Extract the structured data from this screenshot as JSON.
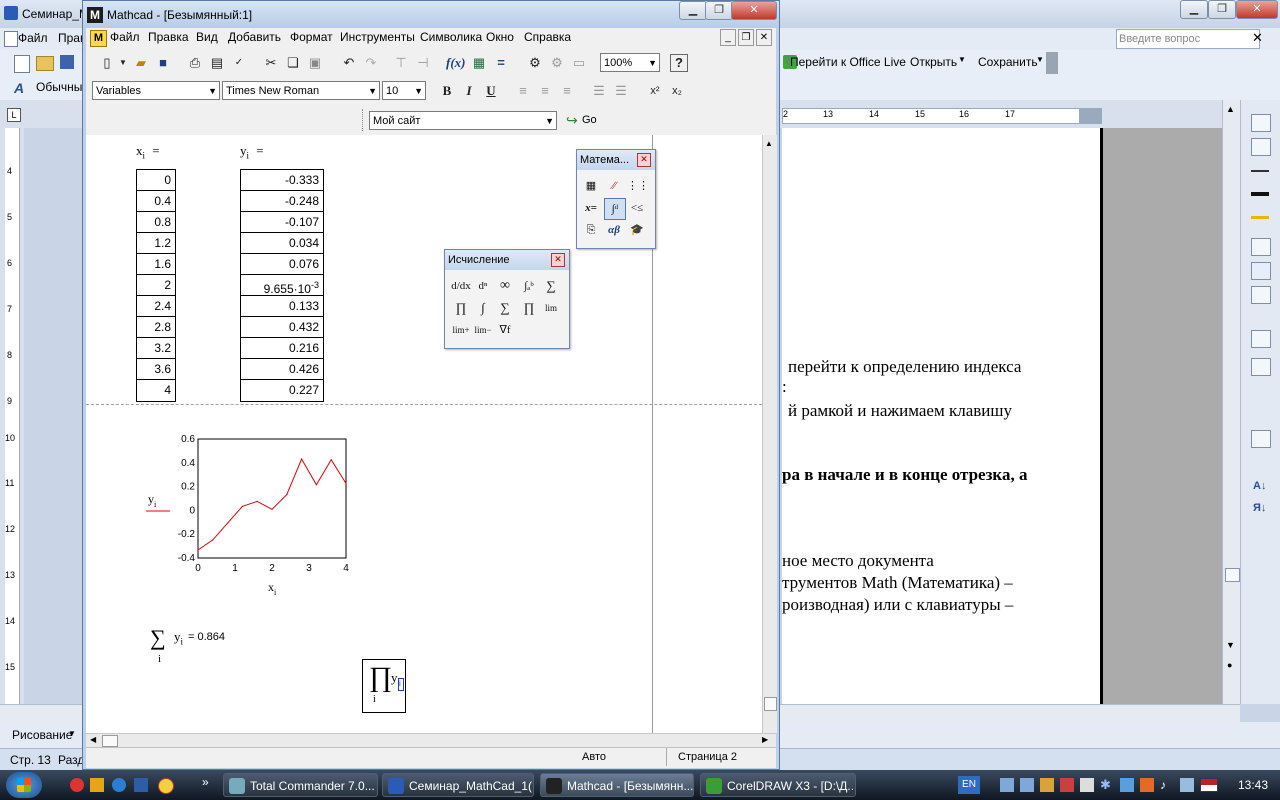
{
  "word": {
    "title": "Семинар_Ма",
    "menu": [
      "Файл",
      "Прав"
    ],
    "style_box": "Обычный",
    "ask_box": "Введите вопрос",
    "toolbar_right": {
      "office_live": "Перейти к Office Live",
      "open": "Открыть",
      "save": "Сохранить"
    },
    "ruler_ticks": [
      "2",
      "13",
      "14",
      "15",
      "16",
      "17"
    ],
    "vruler_ticks": [
      "4",
      "5",
      "6",
      "7",
      "8",
      "9",
      "10",
      "11",
      "12",
      "13",
      "14",
      "15"
    ],
    "page_lines": [
      "перейти к определению индекса",
      ":",
      "й рамкой и нажимаем клавишу",
      "ра в начале и в конце отрезка, а",
      "ное место документа",
      "трументов Math (Математика) –",
      "роизводная) или с клавиатуры –"
    ],
    "draw_label": "Рисование",
    "status": {
      "page": "Стр. 13",
      "section": "Разд"
    }
  },
  "mathcad": {
    "title": "Mathcad - [Безымянный:1]",
    "menu": [
      "Файл",
      "Правка",
      "Вид",
      "Добавить",
      "Формат",
      "Инструменты",
      "Символика",
      "Окно",
      "Справка"
    ],
    "zoom": "100%",
    "style": "Variables",
    "font": "Times New Roman",
    "size": "10",
    "site": "Мой сайт",
    "go": "Go",
    "xi_label": "x",
    "yi_label": "y",
    "sub_i": "i",
    "eq": "=",
    "x_values": [
      "0",
      "0.4",
      "0.8",
      "1.2",
      "1.6",
      "2",
      "2.4",
      "2.8",
      "3.2",
      "3.6",
      "4"
    ],
    "y_values": [
      "-0.333",
      "-0.248",
      "-0.107",
      "0.034",
      "0.076",
      "9.655·10",
      "0.133",
      "0.432",
      "0.216",
      "0.426",
      "0.227"
    ],
    "y_exponent": "-3",
    "sum_result": "= 0.864",
    "sum_symbol": "∑",
    "prod_symbol": "∏",
    "status": {
      "mode": "Авто",
      "page": "Страница 2"
    },
    "palette_math": {
      "title": "Матема..."
    },
    "palette_calc": {
      "title": "Исчисление"
    }
  },
  "chart_data": {
    "type": "line",
    "x": [
      0,
      0.4,
      0.8,
      1.2,
      1.6,
      2,
      2.4,
      2.8,
      3.2,
      3.6,
      4
    ],
    "y": [
      -0.333,
      -0.248,
      -0.107,
      0.034,
      0.076,
      0.009655,
      0.133,
      0.432,
      0.216,
      0.426,
      0.227
    ],
    "xlabel": "x",
    "ylabel": "y",
    "xlim": [
      0,
      4
    ],
    "ylim": [
      -0.4,
      0.6
    ],
    "xticks": [
      "0",
      "1",
      "2",
      "3",
      "4"
    ],
    "yticks": [
      "0.6",
      "0.4",
      "0.2",
      "0",
      "-0.2",
      "-0.4"
    ],
    "color": "#e00000",
    "grid": false
  },
  "taskbar": {
    "items": [
      "Total Commander 7.0...",
      "Семинар_MathCad_1(...",
      "Mathcad - [Безымянн...",
      "CorelDRAW X3 - [D:\\Д..."
    ],
    "lang": "EN",
    "clock": "13:43"
  }
}
